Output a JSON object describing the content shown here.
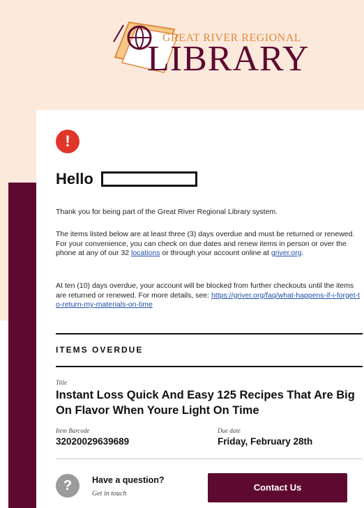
{
  "header": {
    "logo_top": "GREAT RIVER REGIONAL",
    "logo_main": "LIBRARY"
  },
  "notice": {
    "alert_glyph": "!",
    "greeting": "Hello",
    "p1": "Thank you for being part of the Great River Regional Library system.",
    "p2_a": "The items listed below are at least three (3) days overdue and must be returned or renewed. For your convenience, you can check on due dates and renew items in person or over the phone at any of our 32 ",
    "p2_link1": "locations",
    "p2_b": " or through your account online at ",
    "p2_link2": "griver.org",
    "p2_c": ".",
    "p3_a": "At ten (10) days overdue, your account will be blocked from further checkouts until the items are returned or renewed. For more details, see: ",
    "p3_link": "https://griver.org/faq/what-happens-if-i-forget-to-return-my-materials-on-time"
  },
  "items": {
    "section_title": "ITEMS OVERDUE",
    "title_label": "Title",
    "title": "Instant Loss Quick And Easy 125 Recipes That Are Big On Flavor When Youre Light On Time",
    "barcode_label": "Item Barcode",
    "barcode": "32020029639689",
    "due_label": "Due date",
    "due": "Friday, February 28th"
  },
  "footer": {
    "question_glyph": "?",
    "question_title": "Have a question?",
    "question_sub": "Get in touch",
    "contact_button": "Contact Us"
  },
  "colors": {
    "brand_maroon": "#5e0a30",
    "accent_orange": "#e18a3c",
    "alert_red": "#e0362a",
    "header_bg": "#fbe9dc"
  }
}
